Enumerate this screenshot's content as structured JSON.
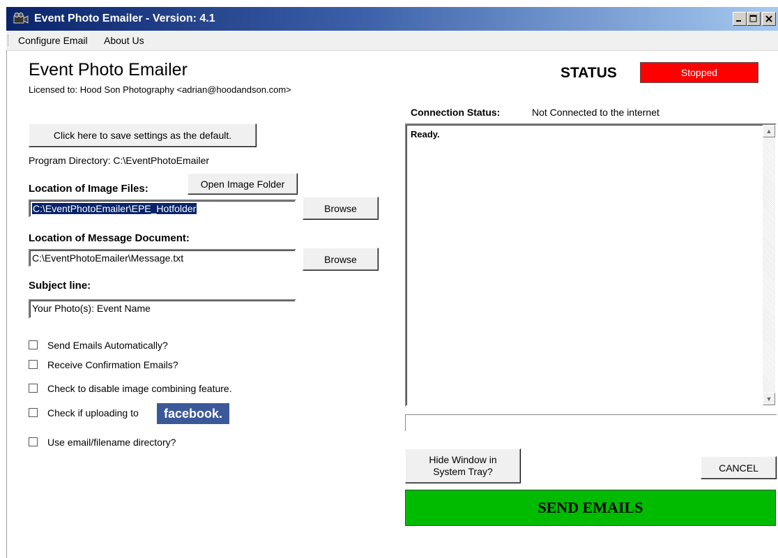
{
  "window": {
    "title": "Event Photo Emailer - Version: 4.1",
    "icon": "film-camera-icon"
  },
  "menu": {
    "items": [
      "Configure Email",
      "About Us"
    ]
  },
  "header": {
    "app_name": "Event Photo Emailer",
    "license": "Licensed to: Hood  Son Photography   <adrian@hoodandson.com>",
    "status_label": "STATUS",
    "status_value": "Stopped",
    "status_color": "#ff0000"
  },
  "settings": {
    "save_default_label": "Click here to save settings as the default.",
    "program_directory": "Program Directory:  C:\\EventPhotoEmailer",
    "image_files_label": "Location of Image Files:",
    "open_image_folder_label": "Open Image Folder",
    "image_files_path": "C:\\EventPhotoEmailer\\EPE_Hotfolder",
    "browse_label": "Browse",
    "message_doc_label": "Location of Message Document:",
    "message_doc_path": "C:\\EventPhotoEmailer\\Message.txt",
    "subject_label": "Subject line:",
    "subject_value": "Your Photo(s): Event Name"
  },
  "options": {
    "send_auto": "Send Emails Automatically?",
    "receive_confirm": "Receive Confirmation Emails?",
    "disable_combining": "Check to disable image combining feature.",
    "facebook_upload": "Check if uploading to",
    "facebook_logo": "facebook.",
    "email_directory": "Use email/filename directory?"
  },
  "connection": {
    "label": "Connection Status:",
    "value": "Not Connected to the internet",
    "log_text": "Ready."
  },
  "actions": {
    "hide_window_line1": "Hide Window in",
    "hide_window_line2": "System Tray?",
    "cancel_label": "CANCEL",
    "send_label": "SEND EMAILS",
    "send_color": "#00bb00"
  }
}
